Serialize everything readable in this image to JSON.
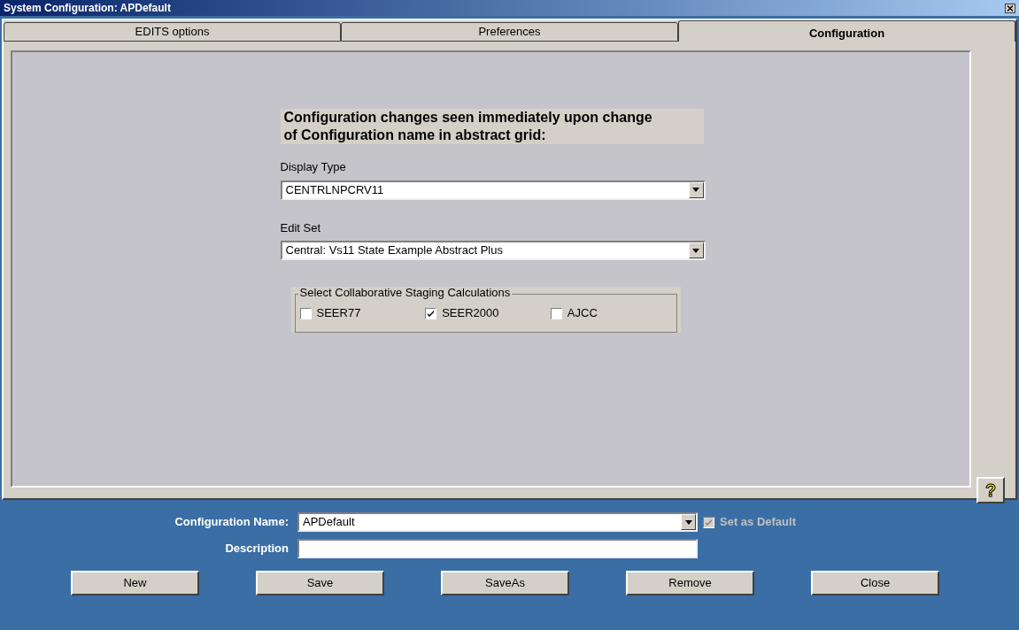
{
  "window": {
    "title": "System Configuration: APDefault"
  },
  "tabs": [
    {
      "label": "EDITS options",
      "selected": false
    },
    {
      "label": "Preferences",
      "selected": false
    },
    {
      "label": "Configuration",
      "selected": true
    }
  ],
  "configuration": {
    "heading": "Configuration changes seen immediately upon change of Configuration name in abstract grid:",
    "display_type": {
      "label": "Display Type",
      "value": "CENTRLNPCRV11"
    },
    "edit_set": {
      "label": "Edit Set",
      "value": "Central: Vs11 State Example Abstract Plus"
    },
    "staging": {
      "title": "Select Collaborative Staging Calculations",
      "options": [
        {
          "label": "SEER77",
          "checked": false
        },
        {
          "label": "SEER2000",
          "checked": true
        },
        {
          "label": "AJCC",
          "checked": false
        }
      ]
    },
    "help_button": "?"
  },
  "footer": {
    "configuration_name": {
      "label": "Configuration Name:",
      "value": "APDefault"
    },
    "set_as_default": {
      "label": "Set as Default",
      "checked": true,
      "disabled": true
    },
    "description": {
      "label": "Description"
    },
    "buttons": [
      "New",
      "Save",
      "SaveAs",
      "Remove",
      "Close"
    ]
  }
}
